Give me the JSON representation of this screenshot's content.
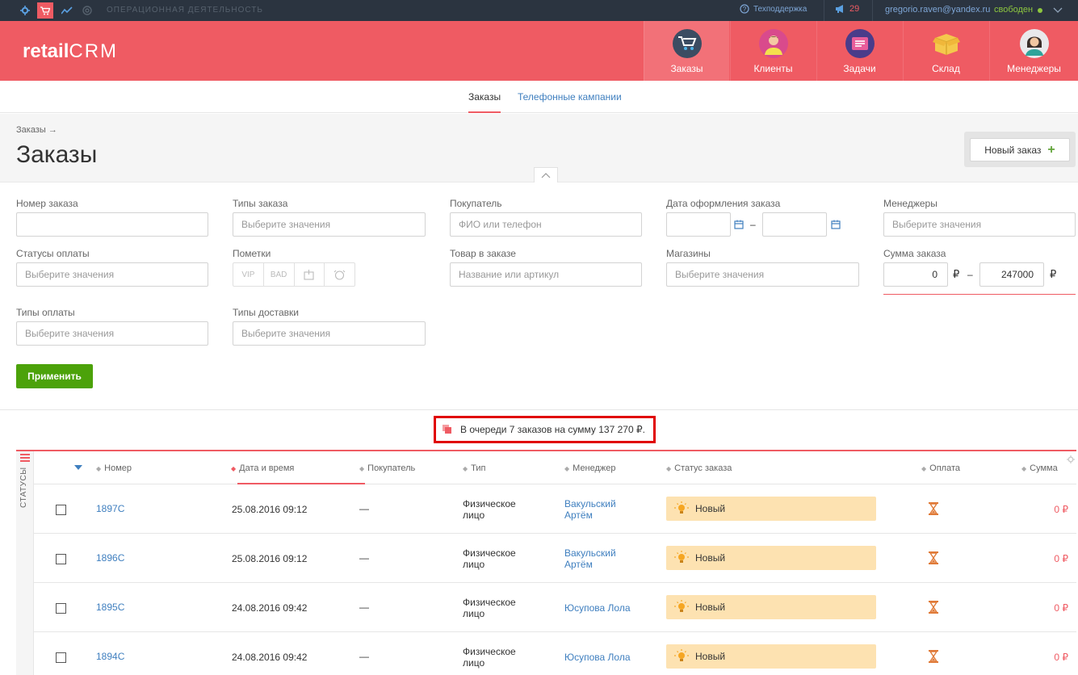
{
  "topbar": {
    "section_title": "ОПЕРАЦИОННАЯ ДЕЯТЕЛЬНОСТЬ",
    "support_label": "Техподдержка",
    "notifications_count": "29",
    "user_email": "gregorio.raven@yandex.ru",
    "user_status": "свободен"
  },
  "logo": {
    "retail": "retail",
    "crm": "CRM"
  },
  "nav": [
    {
      "label": "Заказы",
      "icon": "cart-icon",
      "active": true
    },
    {
      "label": "Клиенты",
      "icon": "client-avatar-icon",
      "active": false
    },
    {
      "label": "Задачи",
      "icon": "tasks-icon",
      "active": false
    },
    {
      "label": "Склад",
      "icon": "warehouse-box-icon",
      "active": false
    },
    {
      "label": "Менеджеры",
      "icon": "manager-avatar-icon",
      "active": false
    }
  ],
  "subnav": {
    "orders": "Заказы",
    "phone_campaigns": "Телефонные кампании"
  },
  "page": {
    "breadcrumb": "Заказы →",
    "title": "Заказы",
    "new_order_label": "Новый заказ"
  },
  "filters": {
    "order_number": {
      "label": "Номер заказа",
      "placeholder": ""
    },
    "order_types": {
      "label": "Типы заказа",
      "placeholder": "Выберите значения"
    },
    "buyer": {
      "label": "Покупатель",
      "placeholder": "ФИО или телефон"
    },
    "order_date": {
      "label": "Дата оформления заказа",
      "separator": "–"
    },
    "managers": {
      "label": "Менеджеры",
      "placeholder": "Выберите значения"
    },
    "payment_statuses": {
      "label": "Статусы оплаты",
      "placeholder": "Выберите значения"
    },
    "marks": {
      "label": "Пометки",
      "items": [
        "VIP",
        "BAD"
      ]
    },
    "product": {
      "label": "Товар в заказе",
      "placeholder": "Название или артикул"
    },
    "shops": {
      "label": "Магазины",
      "placeholder": "Выберите значения"
    },
    "order_sum": {
      "label": "Сумма заказа",
      "from": "0",
      "to": "247000",
      "currency": "₽",
      "separator": "–"
    },
    "payment_types": {
      "label": "Типы оплаты",
      "placeholder": "Выберите значения"
    },
    "delivery_types": {
      "label": "Типы доставки",
      "placeholder": "Выберите значения"
    },
    "apply_label": "Применить"
  },
  "queue_text": "В очереди 7 заказов на сумму 137 270 ₽.",
  "table": {
    "side_label": "СТАТУСЫ",
    "columns": {
      "number": "Номер",
      "datetime": "Дата и время",
      "buyer": "Покупатель",
      "type": "Тип",
      "manager": "Менеджер",
      "status": "Статус заказа",
      "payment": "Оплата",
      "sum": "Сумма"
    },
    "rows": [
      {
        "number": "1897C",
        "datetime": "25.08.2016 09:12",
        "buyer": "—",
        "type": "Физическое лицо",
        "manager": "Вакульский Артём",
        "status": "Новый",
        "sum": "0 ₽"
      },
      {
        "number": "1896C",
        "datetime": "25.08.2016 09:12",
        "buyer": "—",
        "type": "Физическое лицо",
        "manager": "Вакульский Артём",
        "status": "Новый",
        "sum": "0 ₽"
      },
      {
        "number": "1895C",
        "datetime": "24.08.2016 09:42",
        "buyer": "—",
        "type": "Физическое лицо",
        "manager": "Юсупова Лола",
        "status": "Новый",
        "sum": "0 ₽"
      },
      {
        "number": "1894C",
        "datetime": "24.08.2016 09:42",
        "buyer": "—",
        "type": "Физическое лицо",
        "manager": "Юсупова Лола",
        "status": "Новый",
        "sum": "0 ₽"
      }
    ]
  },
  "colors": {
    "brand": "#ef5b63",
    "topbar": "#2b3440",
    "link": "#3f7fbf",
    "apply": "#4ca20a",
    "status_new": "#fde2b1"
  }
}
